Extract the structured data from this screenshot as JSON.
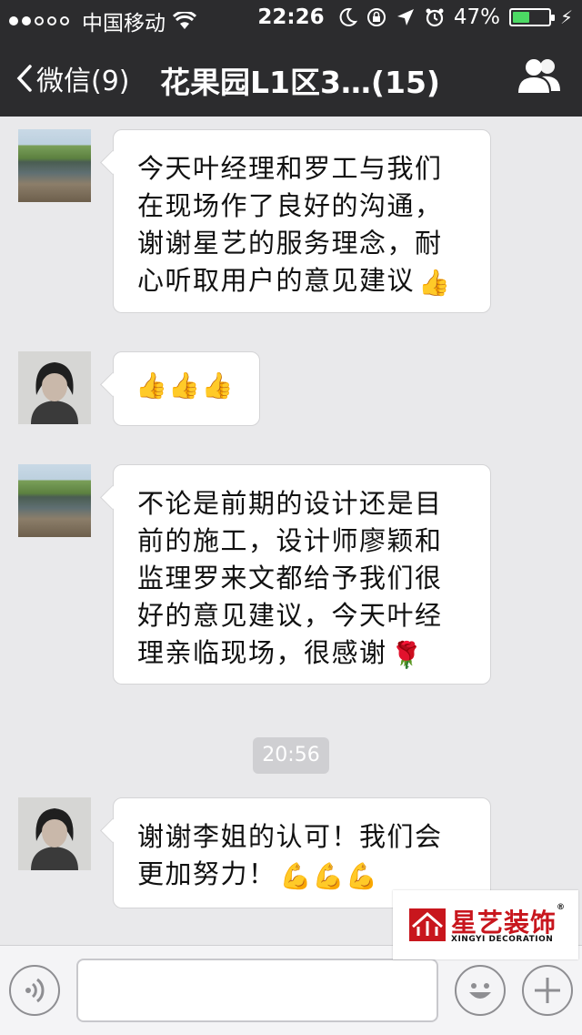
{
  "status_bar": {
    "carrier": "中国移动",
    "time": "22:26",
    "battery_percent": "47%",
    "battery_level": 0.47,
    "signal_bars_filled": 2,
    "signal_bars_total": 5
  },
  "nav": {
    "back_label": "微信(9)",
    "title": "花果园L1区3…(15)",
    "right_icon": "group-members-icon"
  },
  "messages": [
    {
      "avatar": "landscape-avatar",
      "text": "今天叶经理和罗工与我们在现场作了良好的沟通，谢谢星艺的服务理念，耐心听取用户的意见建议",
      "emoji": "👍"
    },
    {
      "avatar": "woman-avatar",
      "text": "",
      "emoji": "👍👍👍"
    },
    {
      "avatar": "landscape-avatar",
      "text": "不论是前期的设计还是目前的施工，设计师廖颖和监理罗来文都给予我们很好的意见建议，今天叶经理亲临现场，很感谢",
      "emoji": "🌹"
    },
    {
      "avatar": "woman-avatar",
      "text": "谢谢李姐的认可！我们会更加努力！",
      "emoji": "💪💪💪"
    }
  ],
  "timestamp": "20:56",
  "input_bar": {
    "voice_icon": "voice-icon",
    "emoji_icon": "smiley-icon",
    "more_icon": "plus-icon"
  },
  "watermark": {
    "name_cn": "星艺装饰",
    "name_en": "XINGYI DECORATION",
    "brand_color": "#c8161d"
  },
  "colors": {
    "nav_bg": "#2c2c2e",
    "chat_bg": "#e9e9eb",
    "battery_green": "#4cd964"
  }
}
